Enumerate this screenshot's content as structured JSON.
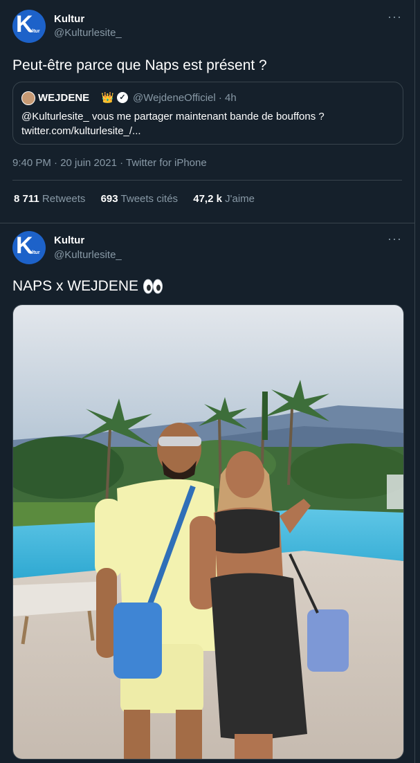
{
  "tweet1": {
    "author_name": "Kultur",
    "author_handle": "@Kulturlesite_",
    "avatar_letter": "K",
    "avatar_small": "ultur",
    "text": "Peut-être parce que Naps est présent ?",
    "quote": {
      "name": "WEJDENE",
      "crown": "👑",
      "handle_time": "@WejdeneOfficiel · 4h",
      "body_line1": "@Kulturlesite_ vous me partager maintenant bande de bouffons ?",
      "body_line2": "twitter.com/kulturlesite_/..."
    },
    "meta": "9:40 PM · 20 juin 2021 · Twitter for iPhone",
    "stats": {
      "retweets_count": "8 711",
      "retweets_label": "Retweets",
      "quotes_count": "693",
      "quotes_label": "Tweets cités",
      "likes_count": "47,2 k",
      "likes_label": "J'aime"
    }
  },
  "tweet2": {
    "author_name": "Kultur",
    "author_handle": "@Kulturlesite_",
    "avatar_letter": "K",
    "avatar_small": "ultur",
    "text": "NAPS x WEJDENE"
  },
  "more_glyph": "···",
  "colors": {
    "background": "#15202b",
    "border": "#38444d",
    "muted": "#8899a6",
    "avatar": "#1d62c9"
  }
}
